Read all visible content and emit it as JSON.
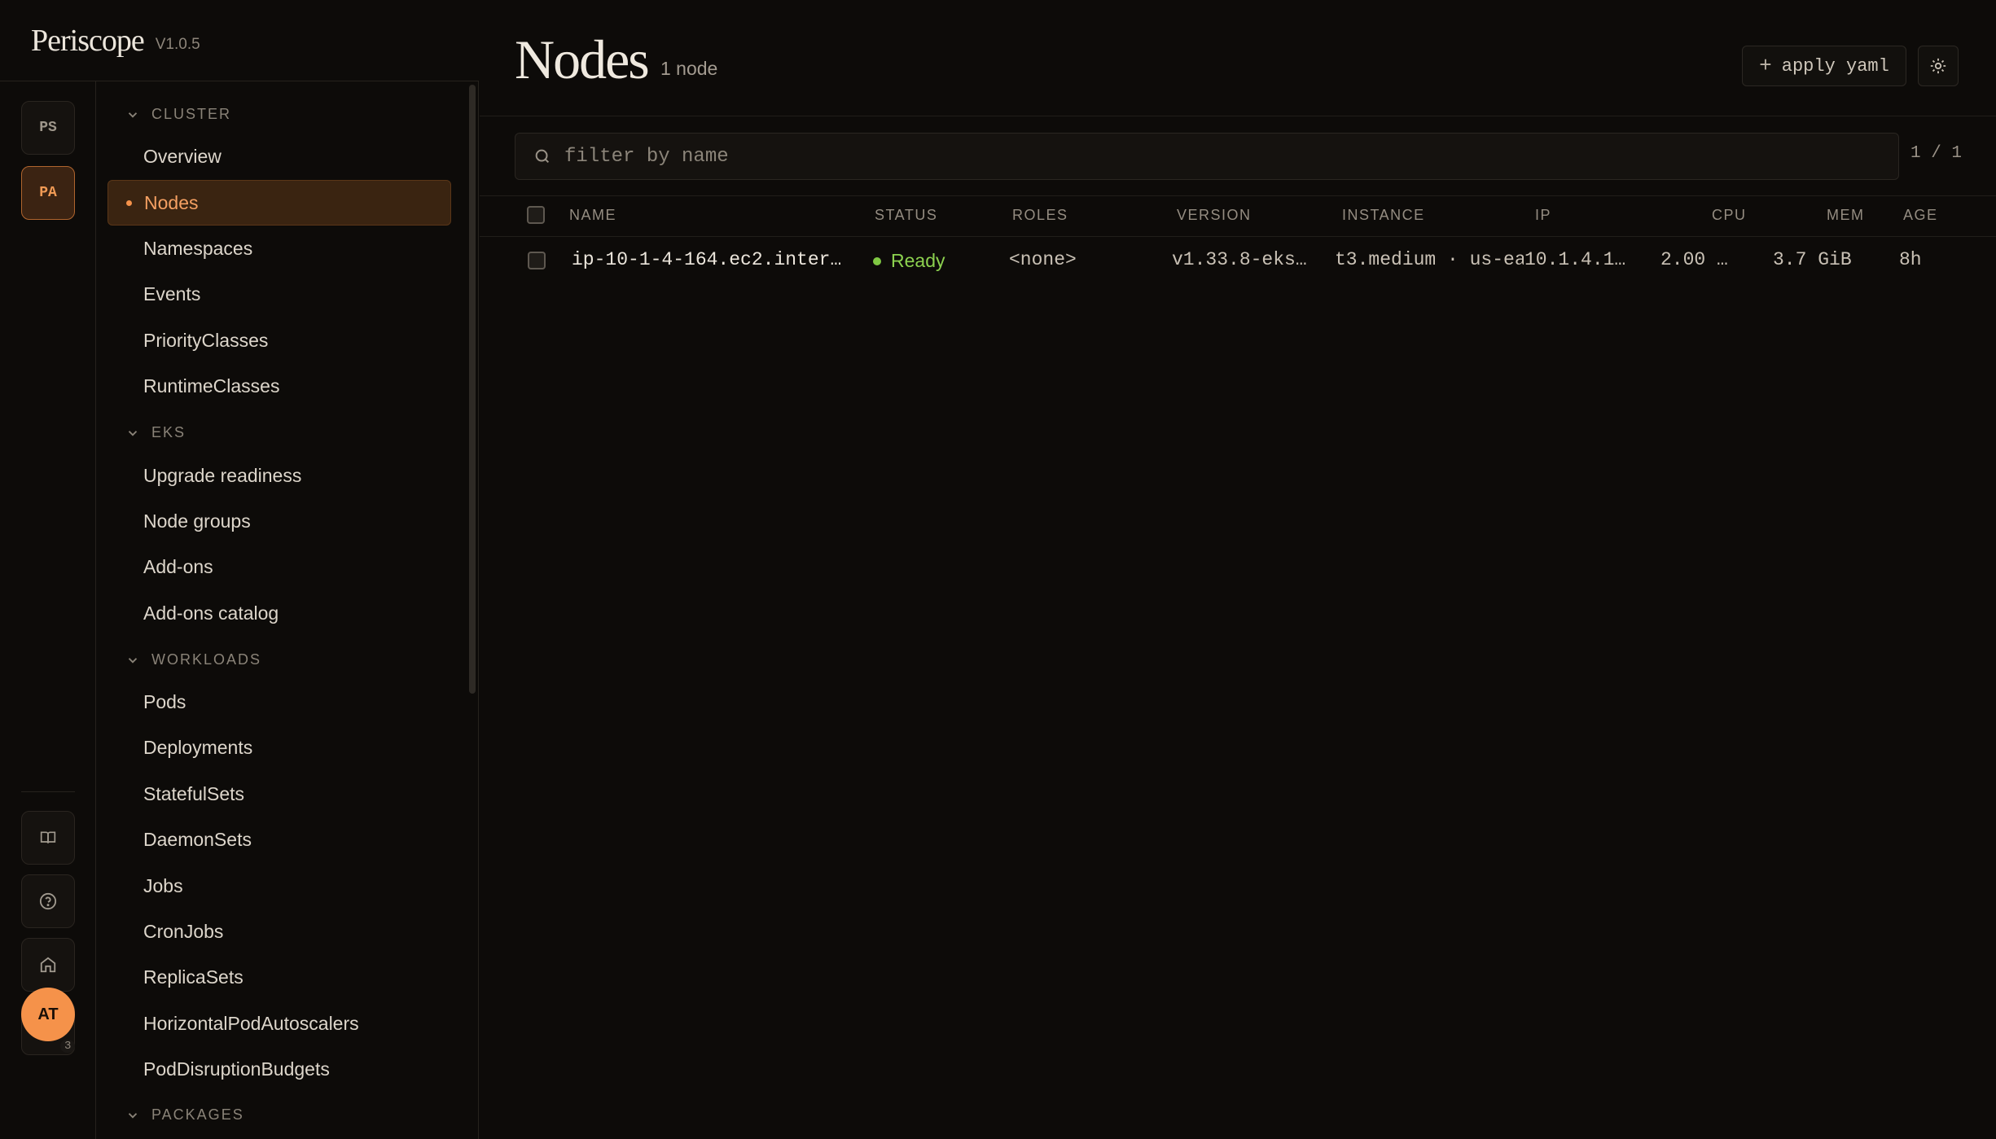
{
  "app": {
    "name": "Periscope",
    "version": "V1.0.5"
  },
  "rail": {
    "contexts": [
      {
        "label": "PS",
        "active": false
      },
      {
        "label": "PA",
        "active": true
      }
    ],
    "bottom_icons": [
      "book-icon",
      "help-icon",
      "home-icon",
      "github-icon"
    ],
    "github_badge": "3",
    "avatar": "AT"
  },
  "nav": {
    "sections": [
      {
        "title": "CLUSTER",
        "items": [
          "Overview",
          "Nodes",
          "Namespaces",
          "Events",
          "PriorityClasses",
          "RuntimeClasses"
        ]
      },
      {
        "title": "EKS",
        "items": [
          "Upgrade readiness",
          "Node groups",
          "Add-ons",
          "Add-ons catalog"
        ]
      },
      {
        "title": "WORKLOADS",
        "items": [
          "Pods",
          "Deployments",
          "StatefulSets",
          "DaemonSets",
          "Jobs",
          "CronJobs",
          "ReplicaSets",
          "HorizontalPodAutoscalers",
          "PodDisruptionBudgets"
        ]
      },
      {
        "title": "PACKAGES",
        "items": []
      }
    ],
    "active_item": "Nodes"
  },
  "page": {
    "title": "Nodes",
    "count": "1 node",
    "apply_label": "apply yaml",
    "apply_icon": "plus-icon",
    "theme_icon": "sun-icon"
  },
  "search": {
    "placeholder": "filter by name",
    "value": "",
    "pager": "1 / 1"
  },
  "table": {
    "columns": [
      "NAME",
      "STATUS",
      "ROLES",
      "VERSION",
      "INSTANCE",
      "IP",
      "CPU",
      "MEM",
      "AGE"
    ],
    "rows": [
      {
        "name": "ip-10-1-4-164.ec2.inter…",
        "status": "Ready",
        "roles": "<none>",
        "version": "v1.33.8-eks…",
        "instance": "t3.medium · us-ea",
        "ip": "10.1.4.1…",
        "cpu": "2.00 …",
        "mem": "3.7 GiB",
        "age": "8h"
      }
    ]
  },
  "colors": {
    "accent": "#f5924a",
    "ready": "#8cd14f",
    "background": "#0d0b09"
  }
}
